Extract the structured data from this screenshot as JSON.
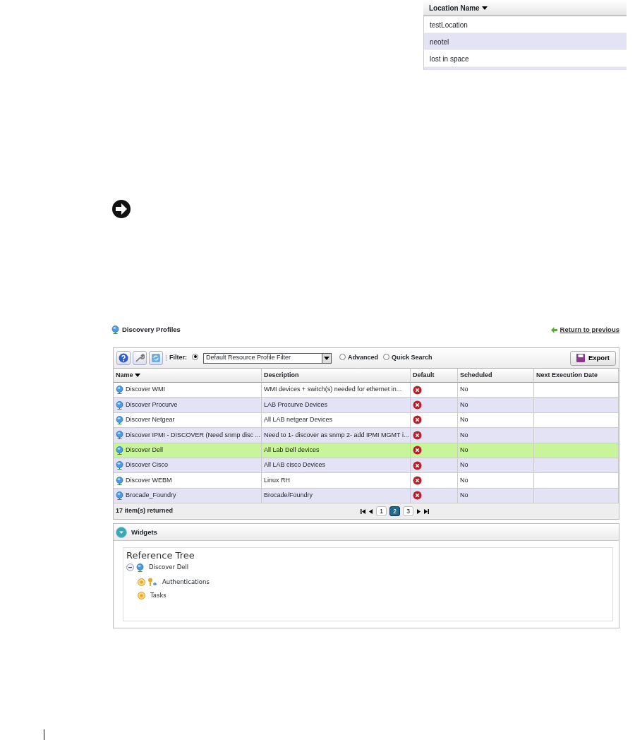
{
  "location_table": {
    "column": "Location Name",
    "rows": [
      {
        "name": "testLocation",
        "selected": false
      },
      {
        "name": "neotel",
        "selected": false
      },
      {
        "name": "lost in space",
        "selected": false
      }
    ]
  },
  "discovery_profiles": {
    "title": "Discovery Profiles",
    "return_link": "Return to previous",
    "toolbar": {
      "filter_label": "Filter:",
      "filter_value": "Default Resource Profile Filter",
      "radios": [
        {
          "selected": true
        },
        {
          "label": "Advanced",
          "selected": false
        },
        {
          "label": "Quick Search",
          "selected": false
        }
      ],
      "export": "Export"
    },
    "columns": [
      "Name",
      "Description",
      "Default",
      "Scheduled",
      "Next Execution Date"
    ],
    "rows": [
      {
        "name": "Discover WMI",
        "description": "WMI devices + switch(s) needed for ethernet in...",
        "default": false,
        "scheduled": "No",
        "selected": false
      },
      {
        "name": "Discover Procurve",
        "description": "LAB Procurve Devices",
        "default": false,
        "scheduled": "No",
        "selected": false
      },
      {
        "name": "Discover Netgear",
        "description": "All LAB netgear Devices",
        "default": false,
        "scheduled": "No",
        "selected": false
      },
      {
        "name": "Discover IPMI - DISCOVER (Need snmp disc ...",
        "description": "Need to 1- discover as snmp 2- add IPMI MGMT i...",
        "default": false,
        "scheduled": "No",
        "selected": false
      },
      {
        "name": "Discover Dell",
        "description": "All Lab Dell devices",
        "default": false,
        "scheduled": "No",
        "selected": true
      },
      {
        "name": "Discover Cisco",
        "description": "All LAB cisco Devices",
        "default": false,
        "scheduled": "No",
        "selected": false
      },
      {
        "name": "Discover WEBM",
        "description": "Linux RH",
        "default": false,
        "scheduled": "No",
        "selected": false
      },
      {
        "name": "Brocade_Foundry",
        "description": "Brocade/Foundry",
        "default": false,
        "scheduled": "No",
        "selected": false
      }
    ],
    "footer": "17 item(s) returned",
    "pages": [
      {
        "label": "1",
        "selected": false
      },
      {
        "label": "2",
        "selected": true
      },
      {
        "label": "3",
        "selected": false
      }
    ]
  },
  "widgets": {
    "title": "Widgets",
    "tree_title": "Reference Tree",
    "tree": [
      {
        "label": "Discover Dell",
        "kind": "profile",
        "expanded": true,
        "children": [
          {
            "label": "Authentications",
            "kind": "key",
            "expanded": false
          },
          {
            "label": "Tasks",
            "kind": "plain",
            "expanded": false
          }
        ]
      }
    ]
  }
}
